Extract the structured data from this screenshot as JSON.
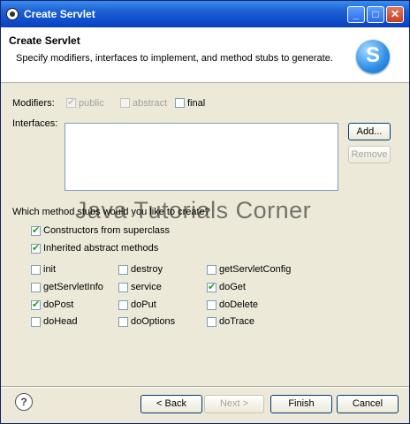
{
  "window": {
    "title": "Create Servlet"
  },
  "titlebar_buttons": {
    "minimize": "_",
    "maximize": "□",
    "close": "✕"
  },
  "banner": {
    "heading": "Create Servlet",
    "description": "Specify modifiers, interfaces to implement, and method stubs to generate.",
    "logo_letter": "S"
  },
  "modifiers": {
    "label": "Modifiers:",
    "public": {
      "label": "public",
      "checked": true,
      "enabled": false
    },
    "abstract": {
      "label": "abstract",
      "checked": false,
      "enabled": false
    },
    "final": {
      "label": "final",
      "checked": false,
      "enabled": true
    }
  },
  "interfaces": {
    "label": "Interfaces:",
    "add_button": "Add...",
    "remove_button": "Remove"
  },
  "method_stubs": {
    "prompt": "Which method stubs would you like to create?",
    "constructors": {
      "label": "Constructors from superclass",
      "checked": true
    },
    "inherited": {
      "label": "Inherited abstract methods",
      "checked": true
    },
    "methods": [
      {
        "label": "init",
        "checked": false
      },
      {
        "label": "destroy",
        "checked": false
      },
      {
        "label": "getServletConfig",
        "checked": false
      },
      {
        "label": "getServletInfo",
        "checked": false
      },
      {
        "label": "service",
        "checked": false
      },
      {
        "label": "doGet",
        "checked": true
      },
      {
        "label": "doPost",
        "checked": true
      },
      {
        "label": "doPut",
        "checked": false
      },
      {
        "label": "doDelete",
        "checked": false
      },
      {
        "label": "doHead",
        "checked": false
      },
      {
        "label": "doOptions",
        "checked": false
      },
      {
        "label": "doTrace",
        "checked": false
      }
    ]
  },
  "watermark": "Java Tutorials Corner",
  "footer": {
    "help": "?",
    "back": "< Back",
    "next": "Next >",
    "finish": "Finish",
    "cancel": "Cancel"
  },
  "check_glyph": "✔",
  "colors": {
    "titlebar": "#0a46c8",
    "check": "#21a121",
    "dialog_bg": "#ece9d8"
  }
}
